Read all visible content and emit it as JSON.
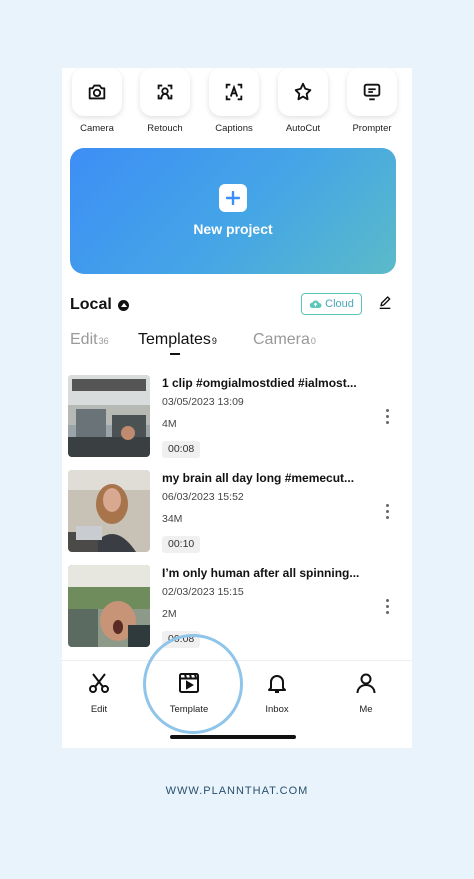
{
  "tools": [
    {
      "label": "Camera",
      "icon": "camera-icon"
    },
    {
      "label": "Retouch",
      "icon": "retouch-icon"
    },
    {
      "label": "Captions",
      "icon": "captions-icon"
    },
    {
      "label": "AutoCut",
      "icon": "autocut-icon"
    },
    {
      "label": "Prompter",
      "icon": "prompter-icon"
    }
  ],
  "new_project": {
    "label": "New project"
  },
  "local": {
    "title": "Local",
    "cloud_label": "Cloud"
  },
  "tabs": [
    {
      "label": "Edit",
      "count": "36",
      "active": false
    },
    {
      "label": "Templates",
      "count": "9",
      "active": true
    },
    {
      "label": "Camera",
      "count": "0",
      "active": false
    }
  ],
  "projects": [
    {
      "title": "1 clip #omgialmostdied #ialmost...",
      "date": "03/05/2023 13:09",
      "size": "4M",
      "duration": "00:08"
    },
    {
      "title": "my brain all day long #memecut...",
      "date": "06/03/2023 15:52",
      "size": "34M",
      "duration": "00:10"
    },
    {
      "title": "I’m only human after all spinning...",
      "date": "02/03/2023 15:15",
      "size": "2M",
      "duration": "00:08"
    }
  ],
  "nav": [
    {
      "label": "Edit",
      "icon": "scissors-icon"
    },
    {
      "label": "Template",
      "icon": "template-icon"
    },
    {
      "label": "Inbox",
      "icon": "bell-icon"
    },
    {
      "label": "Me",
      "icon": "person-icon"
    }
  ],
  "footer": {
    "url": "WWW.PLANNTHAT.COM"
  },
  "colors": {
    "accent": "#3d8ef5",
    "cloud": "#5cc7b8",
    "highlight": "#8fc5ea",
    "background": "#e8f3fb"
  }
}
